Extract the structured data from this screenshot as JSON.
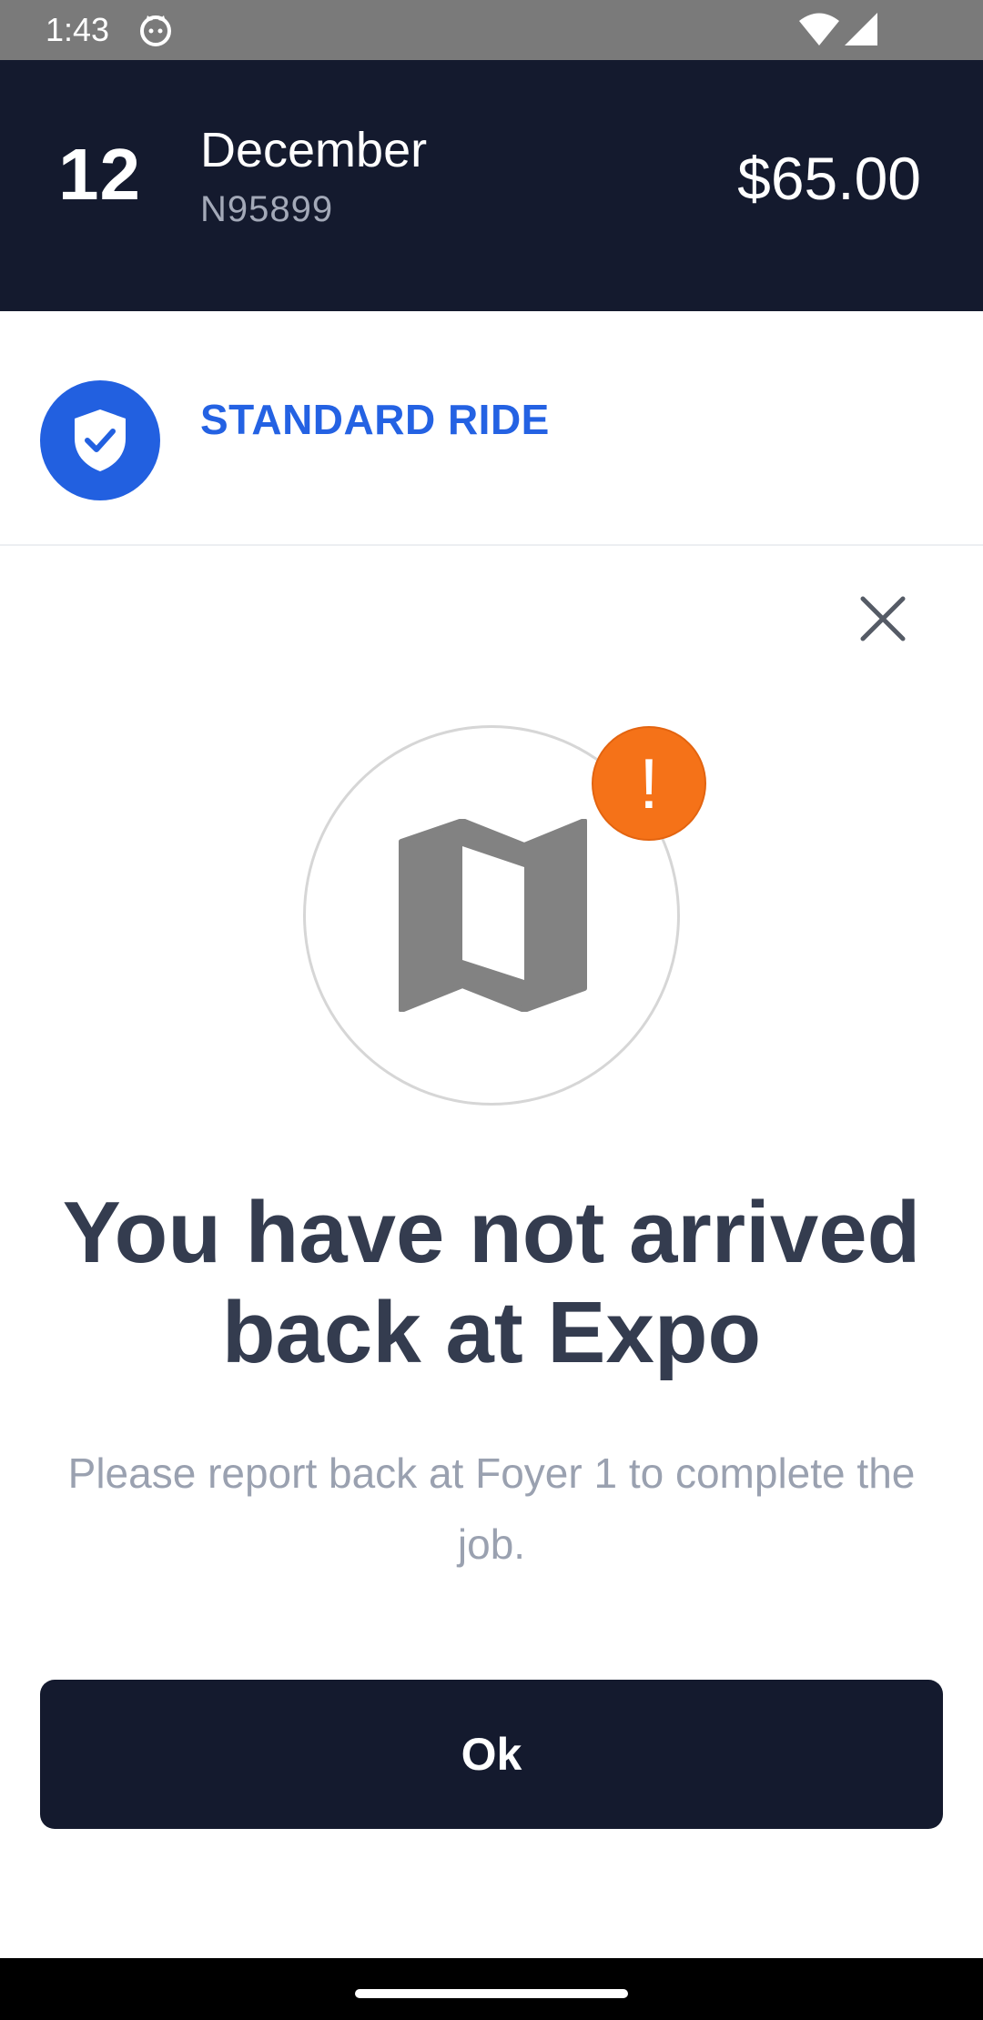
{
  "status_bar": {
    "time": "1:43",
    "icons": [
      "cat-icon",
      "wifi-icon",
      "signal-icon"
    ]
  },
  "header": {
    "day": "12",
    "month": "December",
    "code": "N95899",
    "price": "$65.00"
  },
  "ride": {
    "icon": "shield-check-icon",
    "label": "STANDARD RIDE"
  },
  "modal": {
    "close_icon": "close-icon",
    "illustration_icon": "map-icon",
    "badge": "!",
    "title": "You have not arrived back at Expo",
    "message": "Please report back at Foyer 1 to complete the job.",
    "ok_label": "Ok"
  },
  "colors": {
    "header_bg": "#141a2e",
    "accent_blue": "#2462e3",
    "alert_orange": "#f57218",
    "title_text": "#343c4f",
    "subtitle_text": "#9aa1b0"
  }
}
